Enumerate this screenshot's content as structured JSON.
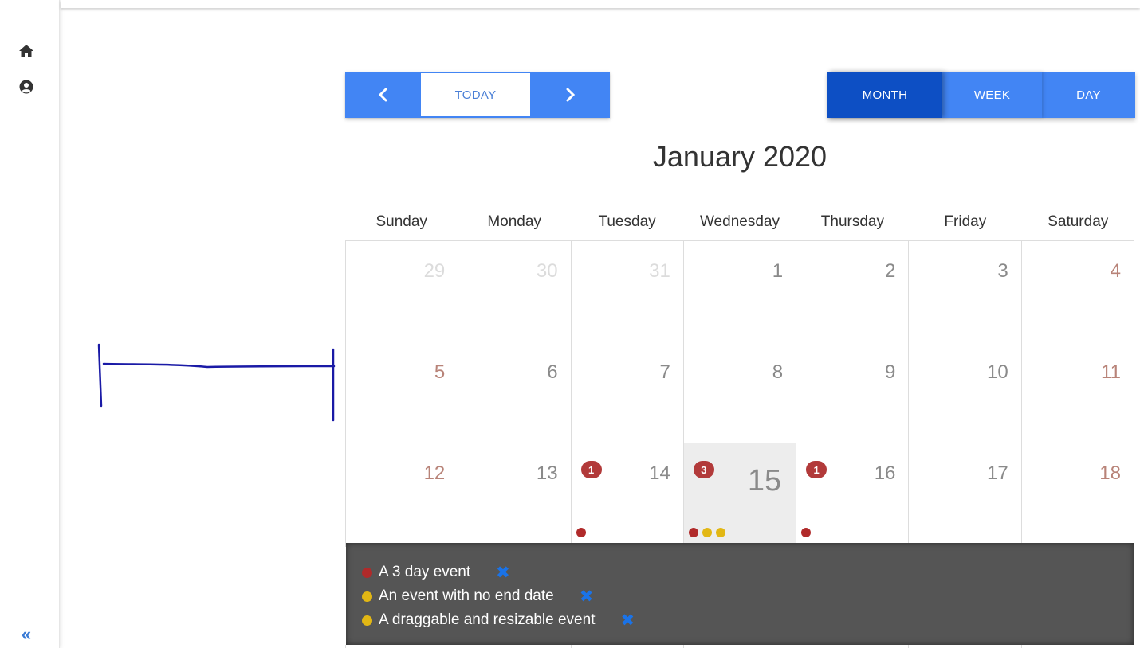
{
  "sidebar": {
    "items": [
      {
        "icon": "home-icon"
      },
      {
        "icon": "user-icon"
      }
    ],
    "collapse_label": "«"
  },
  "toolbar": {
    "prev_icon": "chevron-left-icon",
    "today_label": "TODAY",
    "next_icon": "chevron-right-icon",
    "views": [
      "MONTH",
      "WEEK",
      "DAY"
    ],
    "active_view": "MONTH"
  },
  "calendar": {
    "title": "January 2020",
    "weekdays": [
      "Sunday",
      "Monday",
      "Tuesday",
      "Wednesday",
      "Thursday",
      "Friday",
      "Saturday"
    ],
    "weeks": [
      [
        {
          "day": "29",
          "other_month": true
        },
        {
          "day": "30",
          "other_month": true
        },
        {
          "day": "31",
          "other_month": true
        },
        {
          "day": "1"
        },
        {
          "day": "2"
        },
        {
          "day": "3"
        },
        {
          "day": "4",
          "weekend": true
        }
      ],
      [
        {
          "day": "5",
          "weekend": true
        },
        {
          "day": "6"
        },
        {
          "day": "7"
        },
        {
          "day": "8"
        },
        {
          "day": "9"
        },
        {
          "day": "10"
        },
        {
          "day": "11",
          "weekend": true
        }
      ],
      [
        {
          "day": "12",
          "weekend": true
        },
        {
          "day": "13"
        },
        {
          "day": "14",
          "badge": "1",
          "dots": [
            "#b02a2a"
          ]
        },
        {
          "day": "15",
          "badge": "3",
          "today": true,
          "dots": [
            "#b02a2a",
            "#e2b714",
            "#e2b714"
          ]
        },
        {
          "day": "16",
          "badge": "1",
          "dots": [
            "#b02a2a"
          ]
        },
        {
          "day": "17"
        },
        {
          "day": "18",
          "weekend": true
        }
      ]
    ]
  },
  "events": [
    {
      "title": "A 3 day event",
      "color": "#b02a2a",
      "delete_icon": "close-icon"
    },
    {
      "title": "An event with no end date",
      "color": "#e2b714",
      "delete_icon": "close-icon"
    },
    {
      "title": "A draggable and resizable event",
      "color": "#e2b714",
      "delete_icon": "close-icon"
    }
  ],
  "colors": {
    "primary": "#4285f4",
    "active": "#0d4fc4",
    "danger": "#b23a3a",
    "panel": "#555555"
  }
}
